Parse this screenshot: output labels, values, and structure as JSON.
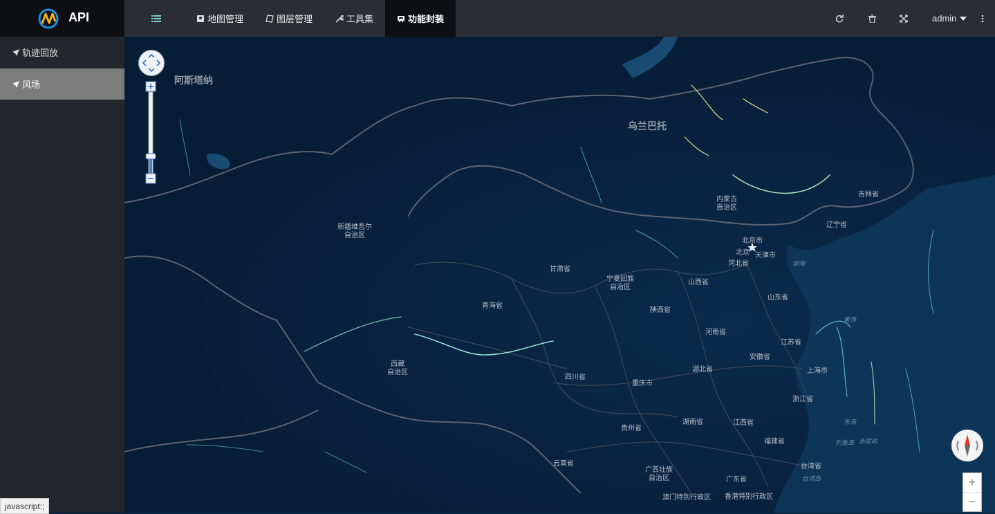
{
  "brand": {
    "name": "API",
    "logo_icon": "nm-logo-icon"
  },
  "nav": {
    "items": [
      {
        "label": "地图管理",
        "icon": "map-icon"
      },
      {
        "label": "图层管理",
        "icon": "layers-icon"
      },
      {
        "label": "工具集",
        "icon": "wrench-icon"
      },
      {
        "label": "功能封装",
        "icon": "package-icon",
        "active": true
      }
    ],
    "right": {
      "user": "admin"
    }
  },
  "sidebar": {
    "items": [
      {
        "label": "轨迹回放",
        "icon": "location-arrow-icon"
      },
      {
        "label": "风场",
        "icon": "location-arrow-icon",
        "active": true
      }
    ]
  },
  "map": {
    "labels": {
      "astana": "阿斯塔纳",
      "ulaanbaatar": "乌兰巴托",
      "xinjiang": "新疆维吾尔\n自治区",
      "neimenggu": "内蒙古\n自治区",
      "jilin": "吉林省",
      "liaoning": "辽宁省",
      "beijing_city": "北京市",
      "beijing": "北京",
      "tianjin": "天津市",
      "hebei": "河北省",
      "gansu": "甘肃省",
      "ningxia": "宁夏回族\n自治区",
      "shanxi": "山西省",
      "shandong": "山东省",
      "qinghai": "青海省",
      "shaanxi": "陕西省",
      "henan": "河南省",
      "jiangsu": "江苏省",
      "anhui": "安徽省",
      "xizang": "西藏\n自治区",
      "sichuan": "四川省",
      "hubei": "湖北省",
      "shanghai": "上海市",
      "chongqing": "重庆市",
      "zhejiang": "浙江省",
      "guizhou": "贵州省",
      "hunan": "湖南省",
      "jiangxi": "江西省",
      "fujian": "福建省",
      "yunnan": "云南省",
      "guangxi": "广西壮族\n自治区",
      "guangdong": "广东省",
      "taiwan": "台湾省",
      "taibei": "台湾岛",
      "macau": "澳门特别行政区",
      "hongkong": "香港特别行政区",
      "bohai": "渤海",
      "huanghai": "黄海",
      "donghai": "东海",
      "diaoyu": "钓鱼岛",
      "chiwei": "赤尾屿"
    }
  },
  "statusbar": {
    "text": "javascript:;"
  }
}
